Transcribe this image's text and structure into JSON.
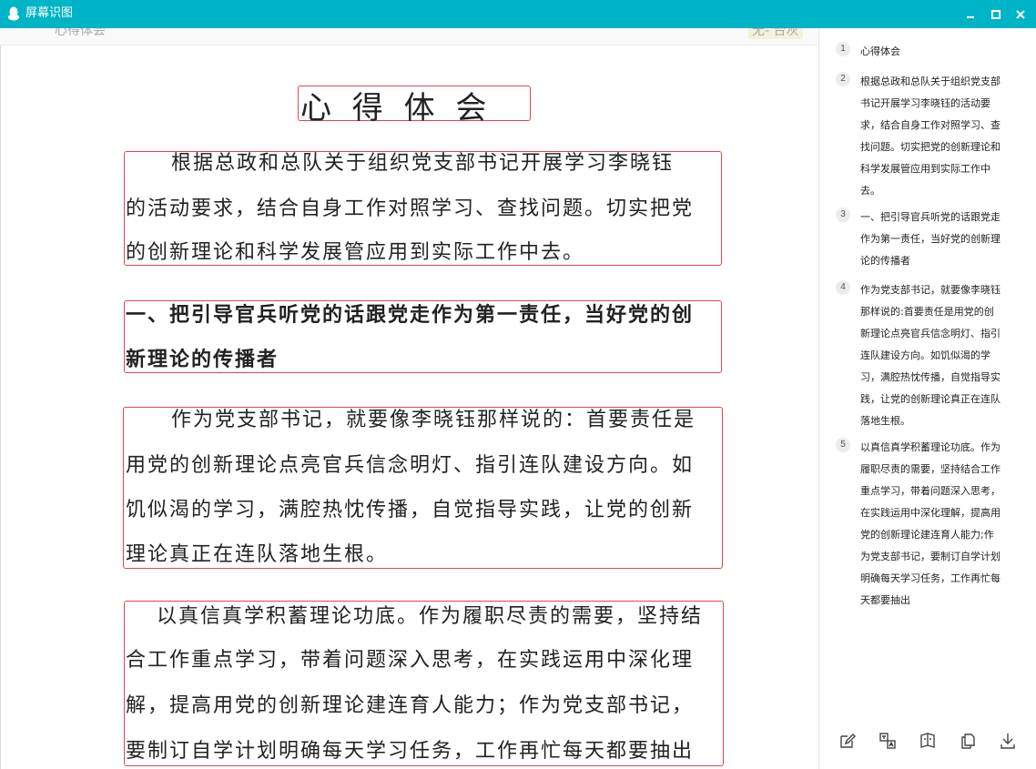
{
  "window": {
    "title": "屏幕识图",
    "icons": [
      "penguin-icon",
      "minimize-icon",
      "maximize-icon",
      "close-icon"
    ]
  },
  "background_doc": {
    "strip_left": "心得体会",
    "strip_right": "无- 台灰"
  },
  "document": {
    "title": "心 得 体 会",
    "para1": [
      "根据总政和总队关于组织党支部书记开展学习李晓钰",
      "的活动要求，结合自身工作对照学习、查找问题。切实把党",
      "的创新理论和科学发展管应用到实际工作中去。"
    ],
    "heading1": [
      "一、把引导官兵听党的话跟党走作为第一责任，当好党的创",
      "新理论的传播者"
    ],
    "para2": [
      "作为党支部书记，就要像李晓钰那样说的：首要责任是",
      "用党的创新理论点亮官兵信念明灯、指引连队建设方向。如",
      "饥似渴的学习，满腔热忱传播，自觉指导实践，让党的创新",
      "理论真正在连队落地生根。"
    ],
    "para3": [
      "以真信真学积蓄理论功底。作为履职尽责的需要，坚持结",
      "合工作重点学习，带着问题深入思考，在实践运用中深化理",
      "解，提高用党的创新理论建连育人能力；作为党支部书记，",
      "要制订自学计划明确每天学习任务，工作再忙每天都要抽出"
    ]
  },
  "results": [
    {
      "num": "1",
      "lines": [
        "心得体会"
      ]
    },
    {
      "num": "2",
      "lines": [
        "根据总政和总队关于组织党支部",
        "书记开展学习李晓钰的活动要",
        "求，结合自身工作对照学习、查",
        "找问题。切实把党的创新理论和",
        "科学发展管应用到实际工作中",
        "去。"
      ]
    },
    {
      "num": "3",
      "lines": [
        "一、把引导官兵听党的话跟党走",
        "作为第一责任，当好党的创新理",
        "论的传播者"
      ]
    },
    {
      "num": "4",
      "lines": [
        "作为党支部书记，就要像李晓钰",
        "那样说的:首要责任是用党的创",
        "新理论点亮官兵信念明灯、指引",
        "连队建设方向。如饥似渴的学",
        "习，满腔热忱传播，自觉指导实",
        "践，让党的创新理论真正在连队",
        "落地生根。"
      ]
    },
    {
      "num": "5",
      "lines": [
        "以真信真学积蓄理论功底。作为",
        "履职尽责的需要，坚持结合工作",
        "重点学习，带着问题深入思考，",
        "在实践运用中深化理解，提高用",
        "党的创新理论建连育人能力;作",
        "为党支部书记，要制订自学计划",
        "明确每天学习任务，工作再忙每",
        "天都要抽出"
      ]
    }
  ],
  "toolbar": {
    "icons": [
      "edit-icon",
      "translate-icon",
      "book-icon",
      "copy-icon",
      "download-icon"
    ]
  },
  "colors": {
    "titlebar": "#00b4c8",
    "highlight_box": "#e0474c"
  }
}
